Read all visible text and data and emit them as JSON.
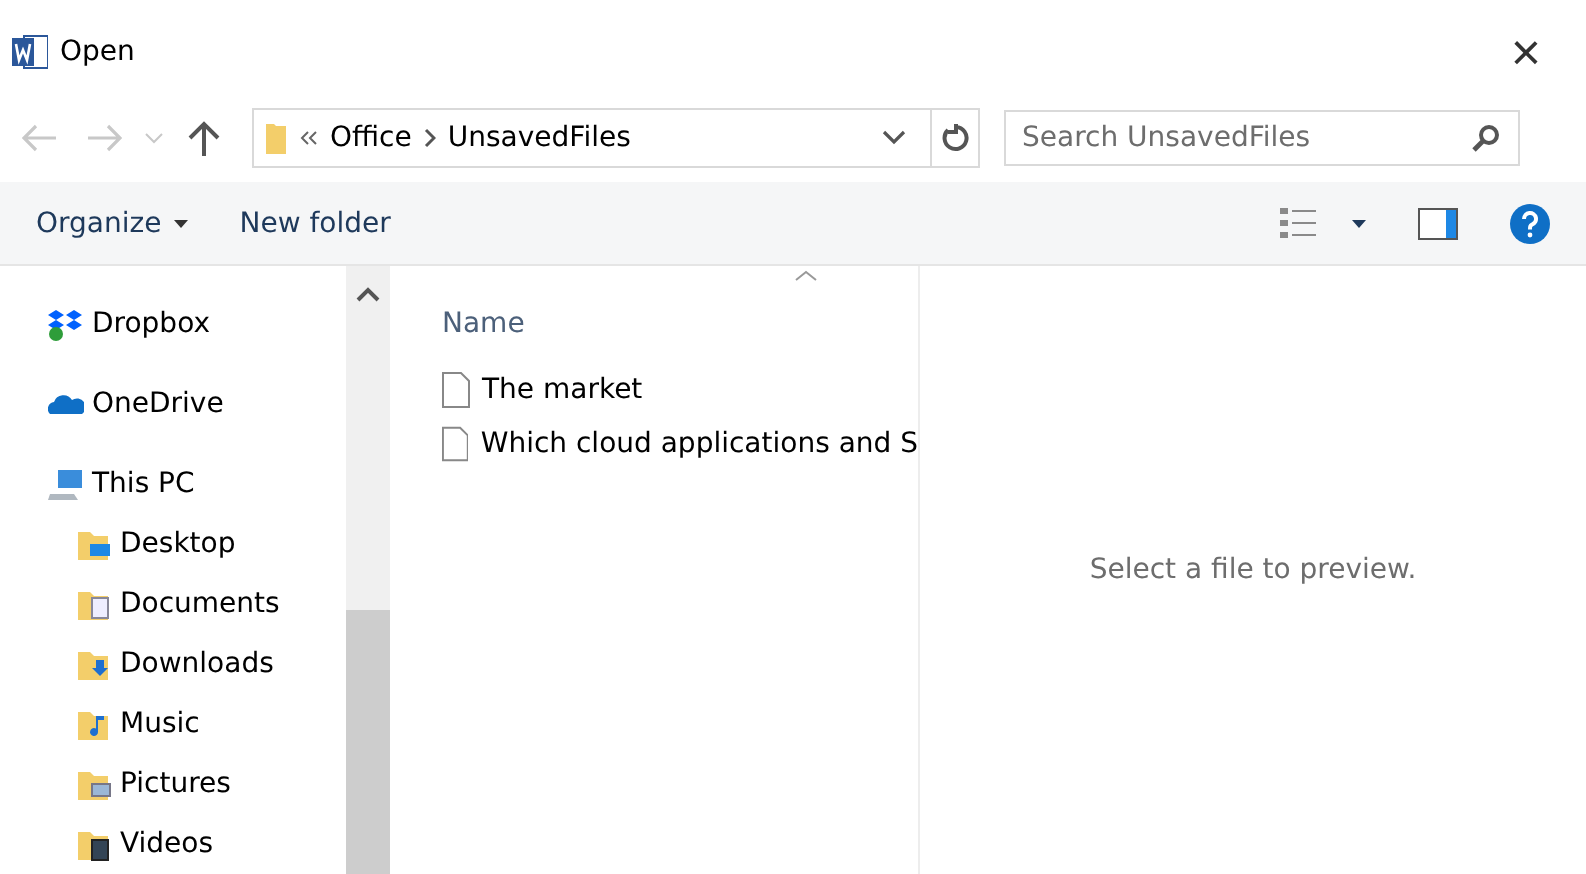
{
  "window": {
    "title": "Open",
    "close": "×"
  },
  "address": {
    "path": [
      "Office",
      "UnsavedFiles"
    ]
  },
  "search": {
    "placeholder": "Search UnsavedFiles"
  },
  "toolbar": {
    "organize": "Organize",
    "new_folder": "New folder"
  },
  "sidebar": {
    "items": [
      {
        "label": "Dropbox",
        "kind": "dropbox"
      },
      {
        "label": "OneDrive",
        "kind": "onedrive"
      },
      {
        "label": "This PC",
        "kind": "pc",
        "children": [
          {
            "label": "Desktop",
            "kind": "desktop"
          },
          {
            "label": "Documents",
            "kind": "documents"
          },
          {
            "label": "Downloads",
            "kind": "downloads"
          },
          {
            "label": "Music",
            "kind": "music"
          },
          {
            "label": "Pictures",
            "kind": "pictures"
          },
          {
            "label": "Videos",
            "kind": "videos"
          }
        ]
      }
    ]
  },
  "file_list": {
    "columns": [
      "Name"
    ],
    "rows": [
      "The market",
      "Which cloud applications and S"
    ]
  },
  "preview": {
    "message": "Select a file to preview."
  }
}
